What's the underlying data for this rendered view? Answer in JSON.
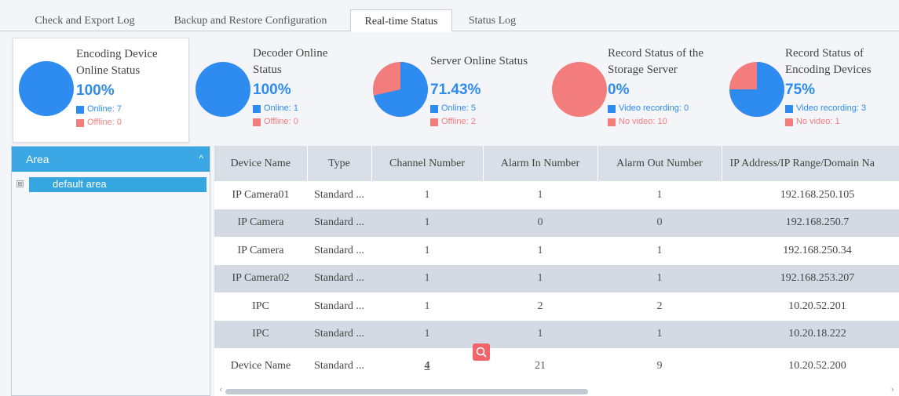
{
  "tabs": [
    {
      "label": "Check and Export Log"
    },
    {
      "label": "Backup and Restore Configuration"
    },
    {
      "label": "Real-time Status"
    },
    {
      "label": "Status Log"
    }
  ],
  "cards": [
    {
      "title_lines": [
        "Encoding Device",
        "Online Status"
      ],
      "percent": "100%",
      "legend": [
        "Online: 7",
        "Offline: 0"
      ],
      "fraction": 1.0
    },
    {
      "title_lines": [
        "Decoder Online",
        "Status"
      ],
      "percent": "100%",
      "legend": [
        "Online: 1",
        "Offline: 0"
      ],
      "fraction": 1.0
    },
    {
      "title_lines": [
        "Server Online Status"
      ],
      "percent": "71.43%",
      "legend": [
        "Online: 5",
        "Offline: 2"
      ],
      "fraction": 0.7143
    },
    {
      "title_lines": [
        "Record Status of the",
        "Storage Server"
      ],
      "percent": "0%",
      "legend": [
        "Video recording: 0",
        "No video: 10"
      ],
      "fraction": 0.0
    },
    {
      "title_lines": [
        "Record Status of",
        "Encoding Devices"
      ],
      "percent": "75%",
      "legend": [
        "Video recording: 3",
        "No video: 1"
      ],
      "fraction": 0.75
    }
  ],
  "colors": {
    "primary": "#2e8cf0",
    "secondary": "#f37d7d",
    "accent": "#3aa6e4"
  },
  "area": {
    "title": "Area",
    "collapse_icon": "chevron-up-icon",
    "tree": [
      {
        "label": "default area",
        "expander": "⊞"
      }
    ]
  },
  "table": {
    "columns": [
      "Device Name",
      "Type",
      "Channel Number",
      "Alarm In Number",
      "Alarm Out Number",
      "IP Address/IP Range/Domain Na"
    ],
    "rows": [
      [
        "IP Camera01",
        "Standard ...",
        "1",
        "1",
        "1",
        "192.168.250.105"
      ],
      [
        "IP Camera",
        "Standard ...",
        "1",
        "0",
        "0",
        "192.168.250.7"
      ],
      [
        "IP Camera",
        "Standard ...",
        "1",
        "1",
        "1",
        "192.168.250.34"
      ],
      [
        "IP Camera02",
        "Standard ...",
        "1",
        "1",
        "1",
        "192.168.253.207"
      ],
      [
        "IPC",
        "Standard ...",
        "1",
        "2",
        "2",
        "10.20.52.201"
      ],
      [
        "IPC",
        "Standard ...",
        "1",
        "1",
        "1",
        "10.20.18.222"
      ],
      [
        "Device Name",
        "Standard ...",
        "4",
        "21",
        "9",
        "10.20.52.200"
      ]
    ]
  },
  "scroll": {
    "left": "‹",
    "right": "›"
  }
}
